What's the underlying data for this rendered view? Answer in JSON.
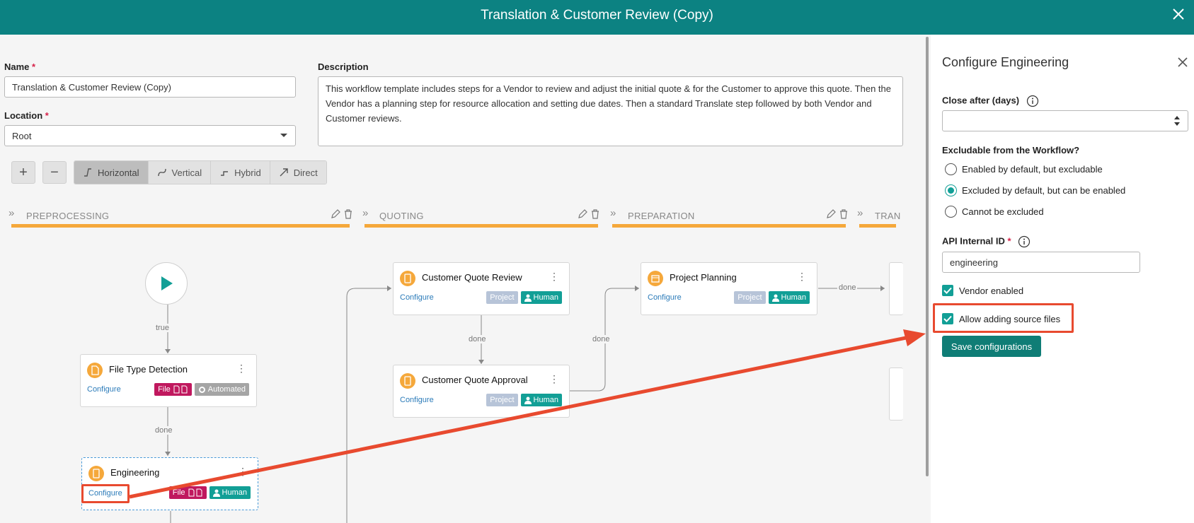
{
  "window": {
    "title": "Translation & Customer Review (Copy)"
  },
  "form": {
    "name_label": "Name",
    "name_value": "Translation & Customer Review (Copy)",
    "location_label": "Location",
    "location_value": "Root",
    "description_label": "Description",
    "description_value": "This workflow template includes steps for a Vendor to review and adjust the initial quote & for the Customer to approve this quote. Then the Vendor has a planning step for resource allocation and setting due dates. Then a standard Translate step followed by both Vendor and Customer reviews.",
    "required_mark": "*"
  },
  "toolbar": {
    "zoom_in": "+",
    "zoom_out": "−",
    "layouts": [
      "Horizontal",
      "Vertical",
      "Hybrid",
      "Direct"
    ],
    "active_layout": "Horizontal"
  },
  "stages": [
    "PREPROCESSING",
    "QUOTING",
    "PREPARATION",
    "TRAN"
  ],
  "nodes": {
    "file_type_detection": {
      "title": "File Type Detection",
      "configure": "Configure",
      "tags": [
        "File",
        "Automated"
      ]
    },
    "engineering": {
      "title": "Engineering",
      "configure": "Configure",
      "tags": [
        "File",
        "Human"
      ]
    },
    "customer_quote_review": {
      "title": "Customer Quote Review",
      "configure": "Configure",
      "tags": [
        "Project",
        "Human"
      ]
    },
    "customer_quote_approval": {
      "title": "Customer Quote Approval",
      "configure": "Configure",
      "tags": [
        "Project",
        "Human"
      ]
    },
    "project_planning": {
      "title": "Project Planning",
      "configure": "Configure",
      "tags": [
        "Project",
        "Human"
      ]
    }
  },
  "edge_labels": {
    "true": "true",
    "done": "done"
  },
  "panel": {
    "title": "Configure Engineering",
    "close_after_label": "Close after (days)",
    "close_after_value": "",
    "excludable_label": "Excludable from the Workflow?",
    "excludable_options": [
      "Enabled by default, but excludable",
      "Excluded by default, but can be enabled",
      "Cannot be excluded"
    ],
    "excludable_selected": "Excluded by default, but can be enabled",
    "api_id_label": "API Internal ID",
    "api_id_value": "engineering",
    "vendor_enabled_label": "Vendor enabled",
    "vendor_enabled": true,
    "allow_source_label": "Allow adding source files",
    "allow_source": true,
    "save_label": "Save configurations"
  },
  "colors": {
    "header": "#0c8282",
    "accent": "#129f96",
    "stage_bar": "#f5a83b",
    "annotation": "#e84a2f",
    "file_tag": "#c0185e"
  }
}
